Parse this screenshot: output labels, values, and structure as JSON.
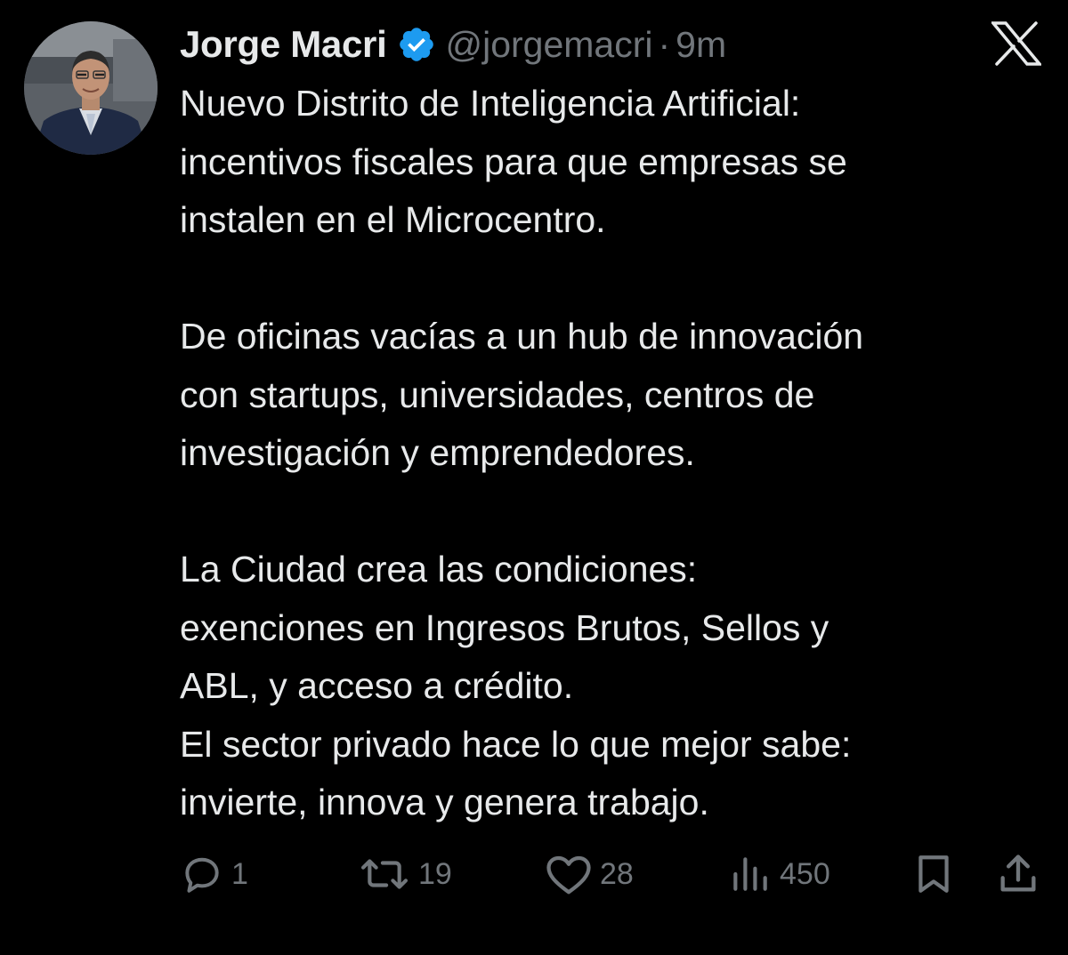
{
  "author": {
    "name": "Jorge Macri",
    "handle": "@jorgemacri",
    "separator": "·",
    "time": "9m"
  },
  "tweet": {
    "lines": [
      "Nuevo Distrito de Inteligencia Artificial:",
      "incentivos fiscales para que empresas se",
      "instalen en el Microcentro.",
      "",
      "De oficinas vacías a un hub de innovación",
      "con startups, universidades, centros de",
      "investigación y emprendedores.",
      "",
      "La Ciudad crea las condiciones:",
      "exenciones en Ingresos Brutos, Sellos y",
      "ABL, y acceso a crédito.",
      "El sector privado hace lo que mejor sabe:",
      "invierte, innova y genera trabajo."
    ]
  },
  "actions": {
    "replies": "1",
    "reposts": "19",
    "likes": "28",
    "views": "450"
  },
  "icons": {
    "verified": "verified-badge-icon",
    "platform": "x-logo-icon",
    "reply": "reply-icon",
    "repost": "repost-icon",
    "like": "heart-icon",
    "views": "views-icon",
    "bookmark": "bookmark-icon",
    "share": "share-icon"
  },
  "colors": {
    "background": "#000000",
    "text": "#e7e9ea",
    "muted": "#71767b",
    "verified": "#1d9bf0"
  }
}
